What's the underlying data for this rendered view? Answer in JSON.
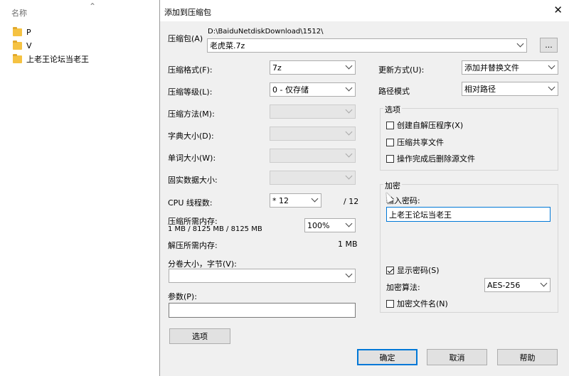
{
  "explorer": {
    "column_header": "名称",
    "files": [
      {
        "name": "P"
      },
      {
        "name": "V"
      },
      {
        "name": "上老王论坛当老王"
      }
    ]
  },
  "dialog": {
    "title": "添加到压缩包",
    "archive": {
      "label": "压缩包(A)",
      "path": "D:\\BaiduNetdiskDownload\\1512\\",
      "name": "老虎菜.7z",
      "browse": "..."
    },
    "left": {
      "format_label": "压缩格式(F):",
      "format_value": "7z",
      "level_label": "压缩等级(L):",
      "level_value": "0 - 仅存储",
      "method_label": "压缩方法(M):",
      "dict_label": "字典大小(D):",
      "word_label": "单词大小(W):",
      "solid_label": "固实数据大小:",
      "cpu_label": "CPU 线程数:",
      "cpu_value": "* 12",
      "cpu_total": "/ 12",
      "mem_comp_label": "压缩所需内存:",
      "mem_comp_value": "1 MB / 8125 MB / 8125 MB",
      "mem_percent": "100%",
      "mem_decomp_label": "解压所需内存:",
      "mem_decomp_value": "1 MB",
      "volume_label": "分卷大小，字节(V):",
      "params_label": "参数(P):",
      "options_button": "选项"
    },
    "right": {
      "update_label": "更新方式(U):",
      "update_value": "添加并替换文件",
      "path_label": "路径模式",
      "path_value": "相对路径",
      "options_group": "选项",
      "opt_sfx": "创建自解压程序(X)",
      "opt_shared": "压缩共享文件",
      "opt_delete": "操作完成后删除源文件",
      "encrypt_group": "加密",
      "password_label": "输入密码:",
      "password_value": "上老王论坛当老王",
      "show_password": "显示密码(S)",
      "algo_label": "加密算法:",
      "algo_value": "AES-256",
      "encrypt_names": "加密文件名(N)"
    },
    "buttons": {
      "ok": "确定",
      "cancel": "取消",
      "help": "帮助"
    }
  }
}
